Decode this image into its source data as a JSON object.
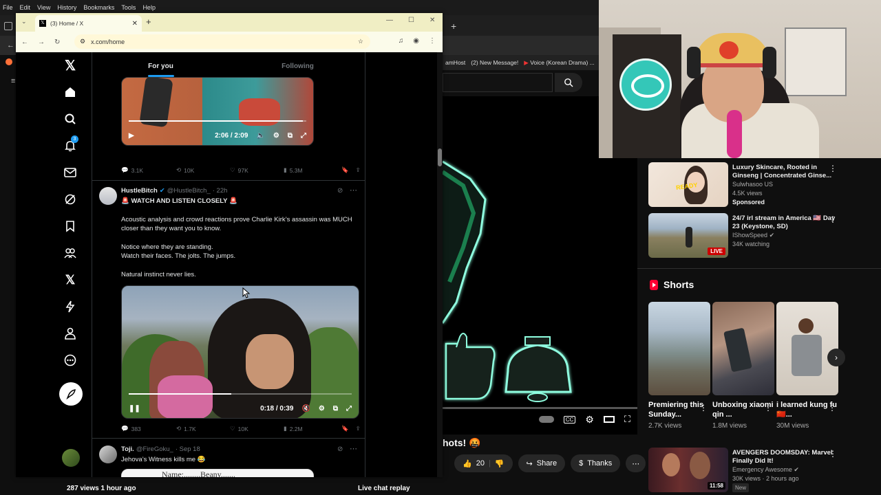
{
  "menubar": {
    "items": [
      "File",
      "Edit",
      "View",
      "History",
      "Bookmarks",
      "Tools",
      "Help"
    ]
  },
  "front_browser": {
    "tab_title": "(3) Home / X",
    "url": "x.com/home"
  },
  "x": {
    "tabs": [
      {
        "label": "For you",
        "active": true
      },
      {
        "label": "Following",
        "active": false
      }
    ],
    "notification_count": "3",
    "post1": {
      "video_time": "2:06 / 2:09",
      "progress": 0.98,
      "stats": {
        "replies": "3.1K",
        "reposts": "10K",
        "likes": "97K",
        "views": "5.3M"
      }
    },
    "post2": {
      "name": "HustleBitch",
      "handle": "@HustleBitch_",
      "time": "· 22h",
      "lines": [
        "🚨 WATCH AND LISTEN CLOSELY 🚨",
        "Acoustic analysis and crowd reactions prove Charlie Kirk’s assassin was MUCH closer than they want you to know.",
        "Notice where they are standing.",
        "Watch their faces. The jolts. The jumps.",
        "Natural instinct never lies."
      ],
      "video_time": "0:18 / 0:39",
      "progress": 0.46,
      "stats": {
        "replies": "383",
        "reposts": "1.7K",
        "likes": "10K",
        "views": "2.2M"
      }
    },
    "post3": {
      "name": "Toji.",
      "handle": "@FireGoku_",
      "time": "· Sep 18",
      "text": "Jehova’s Witness kills me 😂",
      "image_text": "Name:........Beany......."
    }
  },
  "youtube": {
    "bookmarks": [
      "amHost",
      "(2) New Message!",
      "Voice (Korean Drama) ..."
    ],
    "video_title_fragment": "hots! 🤬",
    "likes": "20",
    "share_label": "Share",
    "thanks_label": "Thanks",
    "bottom_left": "287 views  1 hour ago",
    "bottom_right": "Live chat replay",
    "recs": [
      {
        "title": "Luxury Skincare, Rooted in Ginseng | Concentrated Ginse...",
        "channel": "Sulwhasoo US",
        "meta": "4.5K views",
        "badge": "Sponsored",
        "thumb_text": "READY"
      },
      {
        "title": "24/7 irl stream in America 🇺🇸 Day 23 (Keystone, SD)",
        "channel": "IShowSpeed",
        "meta": "34K watching",
        "badge": "LIVE"
      }
    ],
    "shorts_label": "Shorts",
    "shorts": [
      {
        "title": "Premiering this Sunday...",
        "views": "2.7K views"
      },
      {
        "title": "Unboxing xiaomi qin ...",
        "views": "1.8M views"
      },
      {
        "title": "i learned kung fu🇨🇳...",
        "views": "30M views"
      }
    ],
    "rec_bottom": {
      "title": "AVENGERS DOOMSDAY: Marvel Finally Did It!",
      "channel": "Emergency Awesome",
      "meta": "30K views · 2 hours ago",
      "badge": "New",
      "duration": "11:58"
    }
  },
  "colors": {
    "x_blue": "#1d9bf0",
    "yt_red": "#ff0033",
    "bell_glow": "#8fffe0"
  }
}
